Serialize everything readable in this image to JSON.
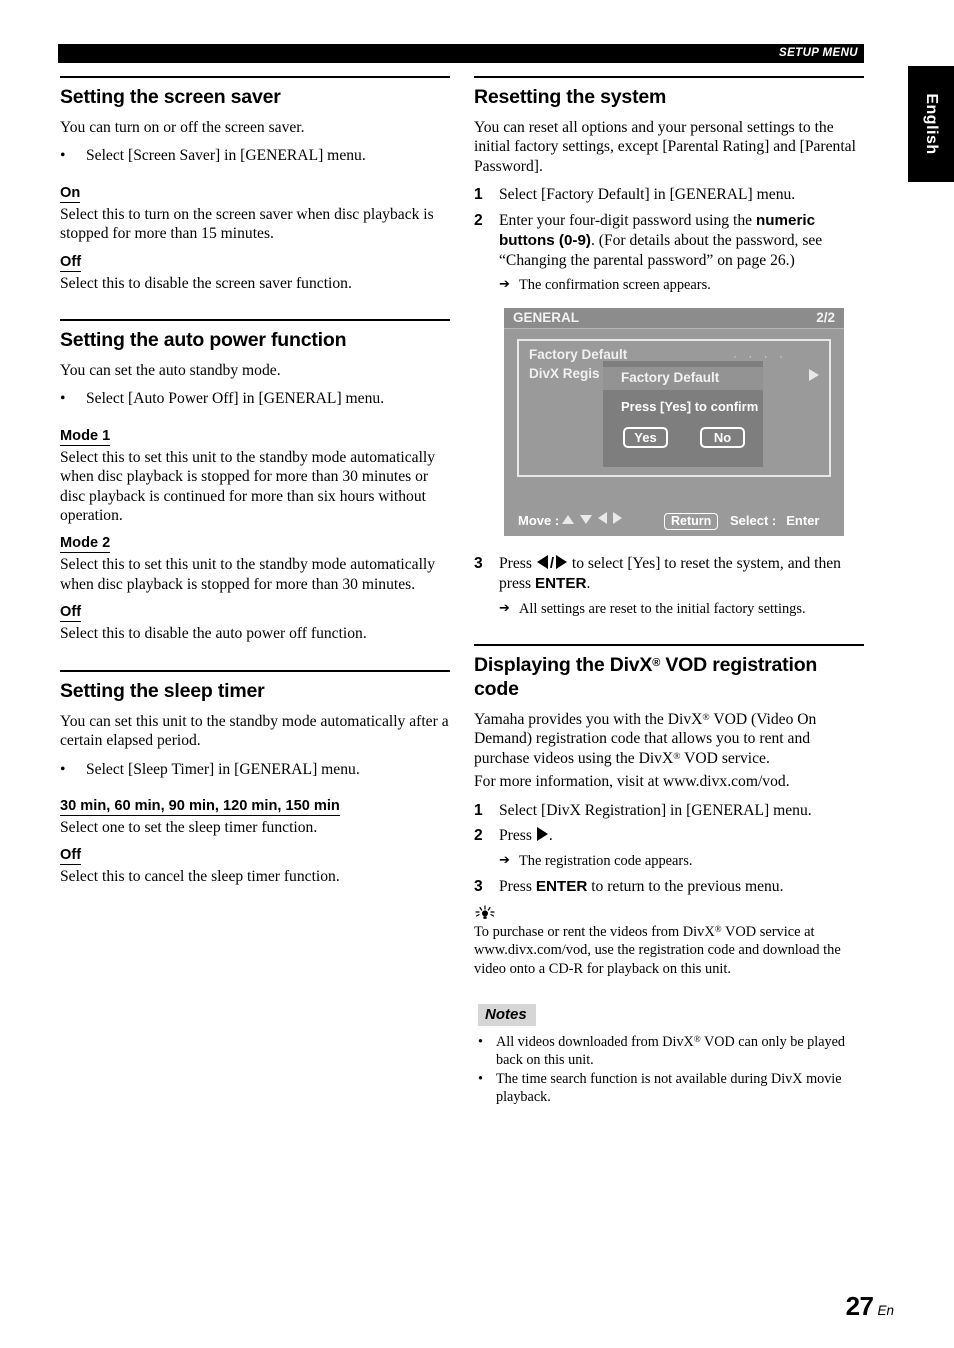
{
  "header": {
    "running_title": "SETUP MENU",
    "language_tab": "English"
  },
  "footer": {
    "page_number": "27",
    "page_language": "En"
  },
  "left_column": {
    "screen_saver": {
      "heading": "Setting the screen saver",
      "intro": "You can turn on or off the screen saver.",
      "bullet_dot": "•",
      "bullet": "Select [Screen Saver] in [GENERAL] menu.",
      "options": [
        {
          "label": "On",
          "description": "Select this to turn on the screen saver when disc playback is stopped for more than 15 minutes."
        },
        {
          "label": "Off",
          "description": "Select this to disable the screen saver function."
        }
      ]
    },
    "auto_power": {
      "heading": "Setting the auto power function",
      "intro": "You can set the auto standby mode.",
      "bullet_dot": "•",
      "bullet": "Select [Auto Power Off] in [GENERAL] menu.",
      "options": [
        {
          "label": "Mode 1",
          "description": "Select this to set this unit to the standby mode automatically when disc playback is stopped for more than 30 minutes or disc playback is continued for more than six hours without operation."
        },
        {
          "label": "Mode 2",
          "description": "Select this to set this unit to the standby mode automatically when disc playback is stopped for more than 30 minutes."
        },
        {
          "label": "Off",
          "description": "Select this to disable the auto power off function."
        }
      ]
    },
    "sleep_timer": {
      "heading": "Setting the sleep timer",
      "intro": "You can set this unit to the standby mode automatically after a certain elapsed period.",
      "bullet_dot": "•",
      "bullet": "Select [Sleep Timer] in [GENERAL] menu.",
      "options": [
        {
          "label": "30 min, 60 min, 90 min, 120 min, 150 min",
          "description": "Select one to set the sleep timer function."
        },
        {
          "label": "Off",
          "description": "Select this to cancel the sleep timer function."
        }
      ]
    }
  },
  "right_column": {
    "resetting": {
      "heading": "Resetting the system",
      "intro": "You can reset all options and your personal settings to the initial factory settings, except [Parental Rating] and [Parental Password].",
      "steps": [
        {
          "num": "1",
          "text_before": "Select [Factory Default] in [GENERAL] menu.",
          "bold": "",
          "text_after": ""
        },
        {
          "num": "2",
          "text_before": "Enter your four-digit password using the ",
          "bold": "numeric buttons (0-9)",
          "text_after": ". (For details about the password, see “Changing the parental password” on page 26.)"
        }
      ],
      "step2_result_arrow": "➔",
      "step2_result": "The confirmation screen appears.",
      "step3": {
        "num": "3",
        "text_before": "Press ",
        "text_mid": " to select [Yes] to reset the system, and then press ",
        "bold": "ENTER",
        "text_after": ".",
        "slash": "/"
      },
      "step3_result_arrow": "➔",
      "step3_result": "All settings are reset to the initial factory settings."
    },
    "osd": {
      "title": "GENERAL",
      "page_indicator": "2/2",
      "rows": [
        {
          "label": "Factory Default",
          "value": "· · · ·"
        },
        {
          "label": "DivX Regis",
          "value": ""
        }
      ],
      "dialog": {
        "title": "Factory Default",
        "message": "Press [Yes] to confirm",
        "yes_label": "Yes",
        "no_label": "No"
      },
      "footer": {
        "move_label": "Move :",
        "return_label": "Return",
        "select_label": "Select :",
        "enter_label": "Enter"
      }
    },
    "divx_vod": {
      "heading_part1": "Displaying the DivX",
      "heading_sup": "®",
      "heading_part2": " VOD registration code",
      "intro_part1": "Yamaha provides you with the DivX",
      "intro_sup1": "®",
      "intro_part2": " VOD (Video On Demand) registration code that allows you to rent and purchase videos using the DivX",
      "intro_sup2": "®",
      "intro_part3": " VOD service.",
      "intro_line2": "For more information, visit at www.divx.com/vod.",
      "steps": [
        {
          "num": "1",
          "text": "Select [DivX Registration] in [GENERAL] menu."
        }
      ],
      "step2": {
        "num": "2",
        "text_before": "Press ",
        "text_after": "."
      },
      "step2_result_arrow": "➔",
      "step2_result": "The registration code appears.",
      "step3": {
        "num": "3",
        "text_before": "Press ",
        "bold": "ENTER",
        "text_after": " to return to the previous menu."
      },
      "tip": {
        "glyph": "tip-bulb-icon",
        "text_part1": "To purchase or rent the videos from DivX",
        "sup": "®",
        "text_part2": " VOD service at www.divx.com/vod, use the registration code and download the video onto a CD-R for playback on this unit."
      },
      "notes": {
        "badge": "Notes",
        "bullet_dot": "•",
        "items": [
          {
            "part1": "All videos downloaded from DivX",
            "sup": "®",
            "part2": " VOD can only be played back on this unit."
          },
          {
            "part1": "The time search function is not available during DivX movie playback.",
            "sup": "",
            "part2": ""
          }
        ]
      }
    }
  },
  "colors": {
    "header_bar": "#000000",
    "osd_background": "#9a9a9a",
    "osd_dialog": "#7e7e7e",
    "notes_badge": "#d6d6d6"
  }
}
